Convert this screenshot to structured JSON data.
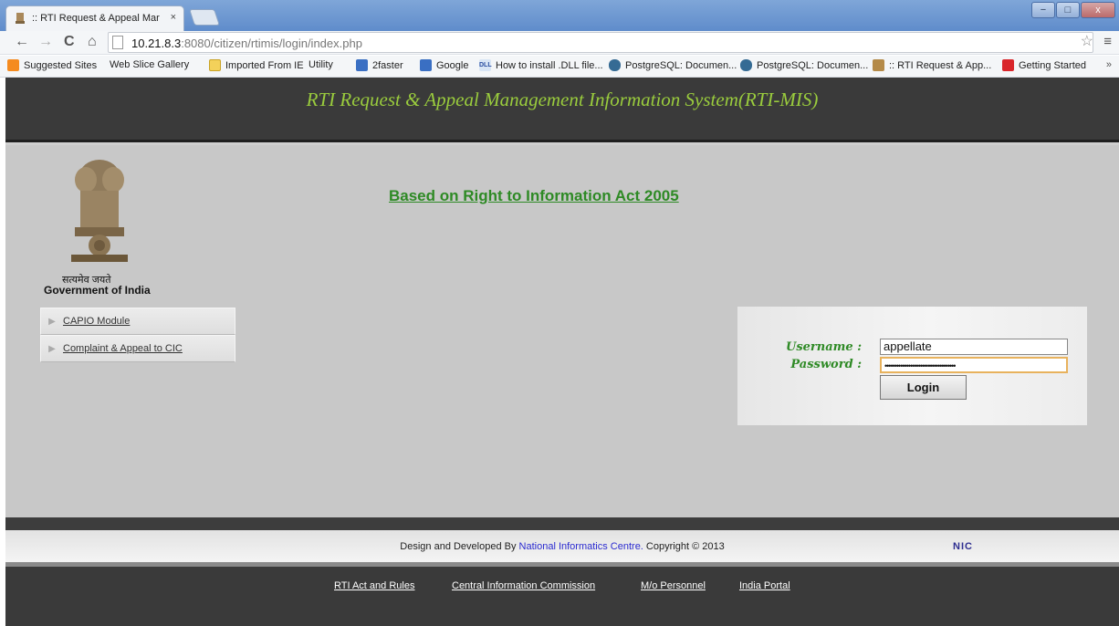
{
  "browser": {
    "tab_title": ":: RTI Request & Appeal Mar",
    "tab_close": "×",
    "url_host": "10.21.8.3",
    "url_path": ":8080/citizen/rtimis/login/index.php",
    "window_minimize": "−",
    "window_maximize": "□",
    "window_close": "x",
    "back_icon": "←",
    "forward_icon": "→",
    "reload_icon": "C",
    "home_icon": "⌂",
    "star_icon": "☆",
    "menu_icon": "≡",
    "bookmarks_overflow": "»"
  },
  "bookmarks": [
    {
      "label": "Suggested Sites",
      "icon": "orange"
    },
    {
      "label": "Web Slice Gallery",
      "icon": "page"
    },
    {
      "label": "Imported From IE",
      "icon": "folder"
    },
    {
      "label": "Utility",
      "icon": "page"
    },
    {
      "label": "2faster",
      "icon": "blue"
    },
    {
      "label": "Google",
      "icon": "blue"
    },
    {
      "label": "How to install .DLL file...",
      "icon": "dll"
    },
    {
      "label": "PostgreSQL: Documen...",
      "icon": "pg"
    },
    {
      "label": "PostgreSQL: Documen...",
      "icon": "pg"
    },
    {
      "label": ":: RTI Request & App...",
      "icon": "emb"
    },
    {
      "label": "Getting Started",
      "icon": "red"
    }
  ],
  "dll_icon_text": "DLL",
  "header": {
    "title": "RTI Request & Appeal Management Information System(RTI-MIS)"
  },
  "emblem": {
    "motto": "सत्यमेव जयते",
    "org": "Government of India"
  },
  "act_link": "Based on Right to Information Act 2005",
  "side_menu": [
    {
      "label": "CAPIO Module"
    },
    {
      "label": "Complaint & Appeal to CIC"
    }
  ],
  "login": {
    "username_label": "Username :",
    "password_label": "Password :",
    "username_value": "appellate",
    "password_value": "••••••••••••••••••••••••••••••••••••",
    "button": "Login"
  },
  "footer": {
    "copy_prefix": "Design and Developed By ",
    "copy_link": "National Informatics Centre.",
    "copy_suffix": " Copyright © 2013",
    "nic": "NIC"
  },
  "footer_links": [
    "RTI Act and Rules",
    "Central Information Commission",
    "M/o Personnel",
    "India Portal"
  ],
  "colors": {
    "accent_green": "#2e8a25",
    "header_title": "#9acc3d",
    "header_bg": "#3a3a3a",
    "content_bg": "#c8c8c8"
  }
}
